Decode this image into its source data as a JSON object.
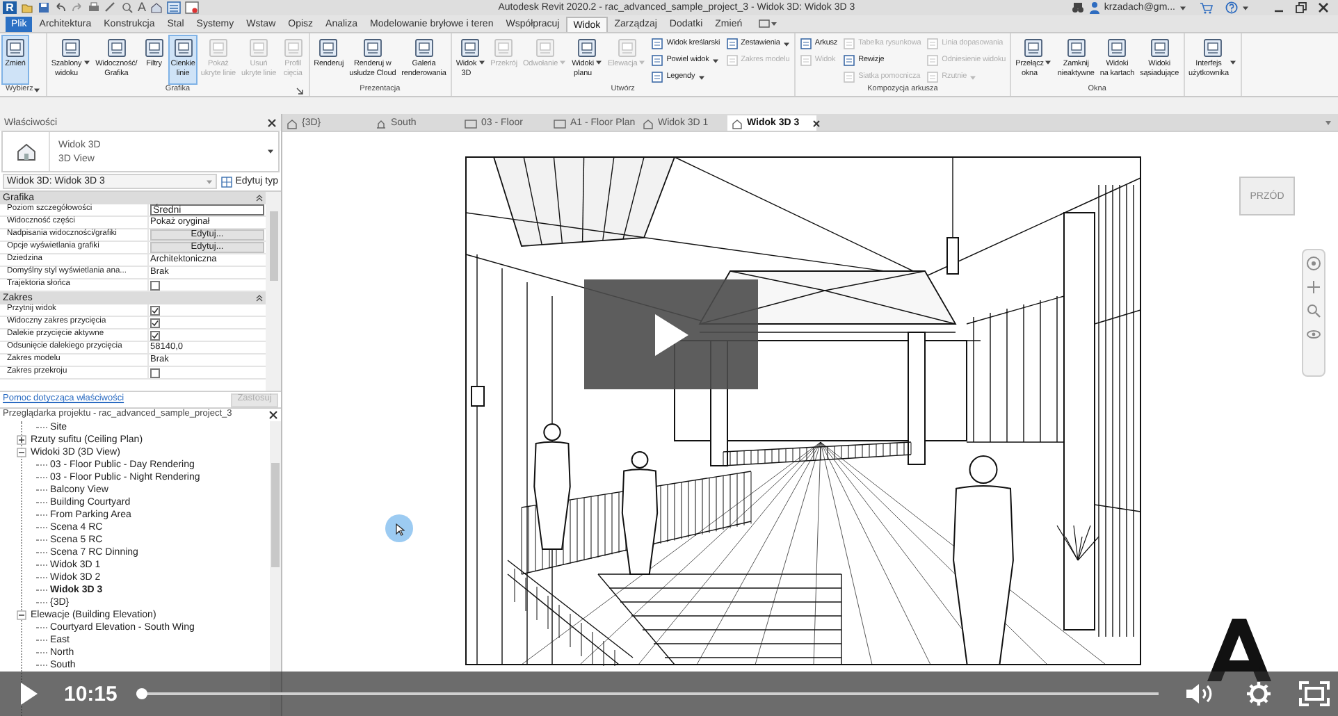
{
  "title_bar": {
    "app_logo": "R",
    "text_tool": "A",
    "title": "Autodesk Revit 2020.2 - rac_advanced_sample_project_3 - Widok 3D: Widok 3D 3",
    "user": "krzadach@gm..."
  },
  "ribbon_tabs": [
    {
      "label": "Plik",
      "kind": "file",
      "selected": false
    },
    {
      "label": "Architektura",
      "kind": "tab",
      "selected": false
    },
    {
      "label": "Konstrukcja",
      "kind": "tab",
      "selected": false
    },
    {
      "label": "Stal",
      "kind": "tab",
      "selected": false
    },
    {
      "label": "Systemy",
      "kind": "tab",
      "selected": false
    },
    {
      "label": "Wstaw",
      "kind": "tab",
      "selected": false
    },
    {
      "label": "Opisz",
      "kind": "tab",
      "selected": false
    },
    {
      "label": "Analiza",
      "kind": "tab",
      "selected": false
    },
    {
      "label": "Modelowanie bryłowe i teren",
      "kind": "tab",
      "selected": false
    },
    {
      "label": "Współpracuj",
      "kind": "tab",
      "selected": false
    },
    {
      "label": "Widok",
      "kind": "tab",
      "selected": true
    },
    {
      "label": "Zarządzaj",
      "kind": "tab",
      "selected": false
    },
    {
      "label": "Dodatki",
      "kind": "tab",
      "selected": false
    },
    {
      "label": "Zmień",
      "kind": "tab",
      "selected": false
    }
  ],
  "ribbon_groups": [
    {
      "label": "Wybierz",
      "dropdown": true,
      "launcher": false,
      "items": [
        {
          "kind": "large",
          "label": "Zmień",
          "selected": true,
          "disabled": false,
          "dropdown": false
        }
      ]
    },
    {
      "label": "Grafika",
      "dropdown": false,
      "launcher": true,
      "items": [
        {
          "kind": "large",
          "label": "Szablony\nwidoku",
          "selected": false,
          "disabled": false,
          "dropdown": true
        },
        {
          "kind": "large",
          "label": "Widoczność/\nGrafika",
          "selected": false,
          "disabled": false,
          "dropdown": false
        },
        {
          "kind": "large",
          "label": "Filtry",
          "selected": false,
          "disabled": false,
          "dropdown": false
        },
        {
          "kind": "large",
          "label": "Cienkie\nlinie",
          "selected": true,
          "disabled": false,
          "dropdown": false
        },
        {
          "kind": "large",
          "label": "Pokaż\nukryte linie",
          "selected": false,
          "disabled": true,
          "dropdown": false
        },
        {
          "kind": "large",
          "label": "Usuń\nukryte linie",
          "selected": false,
          "disabled": true,
          "dropdown": false
        },
        {
          "kind": "large",
          "label": "Profil\ncięcia",
          "selected": false,
          "disabled": true,
          "dropdown": false
        }
      ]
    },
    {
      "label": "Prezentacja",
      "dropdown": false,
      "launcher": false,
      "items": [
        {
          "kind": "large",
          "label": "Renderuj",
          "selected": false,
          "disabled": false,
          "dropdown": false
        },
        {
          "kind": "large",
          "label": "Renderuj w\nusłudze Cloud",
          "selected": false,
          "disabled": false,
          "dropdown": false
        },
        {
          "kind": "large",
          "label": "Galeria\nrenderowania",
          "selected": false,
          "disabled": false,
          "dropdown": false
        }
      ]
    },
    {
      "label": "Utwórz",
      "dropdown": false,
      "launcher": false,
      "items": [
        {
          "kind": "large",
          "label": "Widok\n3D",
          "selected": false,
          "disabled": false,
          "dropdown": true
        },
        {
          "kind": "large",
          "label": "Przekrój",
          "selected": false,
          "disabled": true,
          "dropdown": false
        },
        {
          "kind": "large",
          "label": "Odwołanie",
          "selected": false,
          "disabled": true,
          "dropdown": true
        },
        {
          "kind": "large",
          "label": "Widoki\nplanu",
          "selected": false,
          "disabled": false,
          "dropdown": true
        },
        {
          "kind": "large",
          "label": "Elewacja",
          "selected": false,
          "disabled": true,
          "dropdown": true
        },
        {
          "kind": "column",
          "buttons": [
            {
              "label": "Widok kreślarski",
              "disabled": false,
              "dropdown": false
            },
            {
              "label": "Powiel widok",
              "disabled": false,
              "dropdown": true
            },
            {
              "label": "Legendy",
              "disabled": false,
              "dropdown": true
            }
          ]
        },
        {
          "kind": "column",
          "buttons": [
            {
              "label": "Zestawienia",
              "disabled": false,
              "dropdown": true
            },
            {
              "label": "Zakres modelu",
              "disabled": true,
              "dropdown": false
            }
          ]
        }
      ]
    },
    {
      "label": "Kompozycja arkusza",
      "dropdown": false,
      "launcher": false,
      "items": [
        {
          "kind": "column",
          "buttons": [
            {
              "label": "Arkusz",
              "disabled": false,
              "dropdown": false
            },
            {
              "label": "Widok",
              "disabled": true,
              "dropdown": false
            }
          ]
        },
        {
          "kind": "column",
          "buttons": [
            {
              "label": "Tabelka rysunkowa",
              "disabled": true,
              "dropdown": false
            },
            {
              "label": "Rewizje",
              "disabled": false,
              "dropdown": false
            },
            {
              "label": "Siatka pomocnicza",
              "disabled": true,
              "dropdown": false
            }
          ]
        },
        {
          "kind": "column",
          "buttons": [
            {
              "label": "Linia dopasowania",
              "disabled": true,
              "dropdown": false
            },
            {
              "label": "Odniesienie widoku",
              "disabled": true,
              "dropdown": false
            },
            {
              "label": "Rzutnie",
              "disabled": true,
              "dropdown": true
            }
          ]
        }
      ]
    },
    {
      "label": "Okna",
      "dropdown": false,
      "launcher": false,
      "items": [
        {
          "kind": "large",
          "label": "Przełącz\nokna",
          "selected": false,
          "disabled": false,
          "dropdown": true
        },
        {
          "kind": "large",
          "label": "Zamknij\nnieaktywne",
          "selected": false,
          "disabled": false,
          "dropdown": false
        },
        {
          "kind": "large",
          "label": "Widoki\nna kartach",
          "selected": false,
          "disabled": false,
          "dropdown": false
        },
        {
          "kind": "large",
          "label": "Widoki\nsąsiadujące",
          "selected": false,
          "disabled": false,
          "dropdown": false
        }
      ]
    },
    {
      "dropdown": false,
      "launcher": false,
      "items": [
        {
          "kind": "large",
          "label": "Interfejs\nużytkownika",
          "selected": false,
          "disabled": false,
          "dropdown": true
        }
      ]
    }
  ],
  "properties": {
    "title": "Właściwości",
    "type_name": "Widok 3D",
    "type_subname": "3D View",
    "instance_selector": "Widok 3D: Widok 3D 3",
    "edit_type": "Edytuj typ",
    "sections": [
      {
        "label": "Grafika",
        "rows": [
          {
            "name": "Poziom szczegółowości",
            "kind": "field",
            "value": "Średni"
          },
          {
            "name": "Widoczność części",
            "kind": "text",
            "value": "Pokaż oryginał"
          },
          {
            "name": "Nadpisania widoczności/grafiki",
            "kind": "button",
            "value": "Edytuj..."
          },
          {
            "name": "Opcje wyświetlania grafiki",
            "kind": "button",
            "value": "Edytuj..."
          },
          {
            "name": "Dziedzina",
            "kind": "text",
            "value": "Architektoniczna"
          },
          {
            "name": "Domyślny styl wyświetlania ana...",
            "kind": "text",
            "value": "Brak"
          },
          {
            "name": "Trajektoria słońca",
            "kind": "checkbox",
            "checked": false
          }
        ]
      },
      {
        "label": "Zakres",
        "rows": [
          {
            "name": "Przytnij widok",
            "kind": "checkbox",
            "checked": true
          },
          {
            "name": "Widoczny zakres przycięcia",
            "kind": "checkbox",
            "checked": true
          },
          {
            "name": "Dalekie przycięcie aktywne",
            "kind": "checkbox",
            "checked": true
          },
          {
            "name": "Odsunięcie dalekiego przycięcia",
            "kind": "text",
            "value": "58140,0"
          },
          {
            "name": "Zakres modelu",
            "kind": "text",
            "value": "Brak"
          },
          {
            "name": "Zakres przekroju",
            "kind": "checkbox",
            "checked": false
          }
        ]
      }
    ],
    "help_link": "Pomoc dotycząca właściwości",
    "apply": "Zastosuj",
    "apply_disabled": true
  },
  "browser": {
    "title": "Przeglądarka projektu - rac_advanced_sample_project_3",
    "tree": [
      {
        "kind": "view",
        "label": "Site",
        "active": false
      },
      {
        "kind": "folder",
        "label": "Rzuty sufitu (Ceiling Plan)",
        "expanded": false
      },
      {
        "kind": "folder",
        "label": "Widoki 3D (3D View)",
        "expanded": true,
        "children": [
          {
            "kind": "view",
            "label": "03 - Floor Public - Day Rendering",
            "active": false
          },
          {
            "kind": "view",
            "label": "03 - Floor Public - Night Rendering",
            "active": false
          },
          {
            "kind": "view",
            "label": "Balcony View",
            "active": false
          },
          {
            "kind": "view",
            "label": "Building Courtyard",
            "active": false
          },
          {
            "kind": "view",
            "label": "From Parking Area",
            "active": false
          },
          {
            "kind": "view",
            "label": "Scena 4 RC",
            "active": false
          },
          {
            "kind": "view",
            "label": "Scena 5 RC",
            "active": false
          },
          {
            "kind": "view",
            "label": "Scena 7 RC Dinning",
            "active": false
          },
          {
            "kind": "view",
            "label": "Widok 3D 1",
            "active": false
          },
          {
            "kind": "view",
            "label": "Widok 3D 2",
            "active": false
          },
          {
            "kind": "view",
            "label": "Widok 3D 3",
            "active": true
          },
          {
            "kind": "view",
            "label": "{3D}",
            "active": false
          }
        ]
      },
      {
        "kind": "folder",
        "label": "Elewacje (Building Elevation)",
        "expanded": true,
        "children": [
          {
            "kind": "view",
            "label": "Courtyard Elevation - South Wing",
            "active": false
          },
          {
            "kind": "view",
            "label": "East",
            "active": false
          },
          {
            "kind": "view",
            "label": "North",
            "active": false
          },
          {
            "kind": "view",
            "label": "South",
            "active": false
          }
        ]
      }
    ]
  },
  "view_tabs": [
    {
      "label": "{3D}",
      "kind": "model",
      "selected": false
    },
    {
      "label": "South",
      "kind": "elevation",
      "selected": false
    },
    {
      "label": "03 - Floor",
      "kind": "plan",
      "selected": false
    },
    {
      "label": "A1 - Floor Plan",
      "kind": "plan",
      "selected": false
    },
    {
      "label": "Widok 3D 1",
      "kind": "model",
      "selected": false
    },
    {
      "label": "Widok 3D 3",
      "kind": "model",
      "selected": true
    }
  ],
  "viewcube": {
    "face": "PRZÓD"
  },
  "video": {
    "time": "10:15",
    "level": 0
  }
}
